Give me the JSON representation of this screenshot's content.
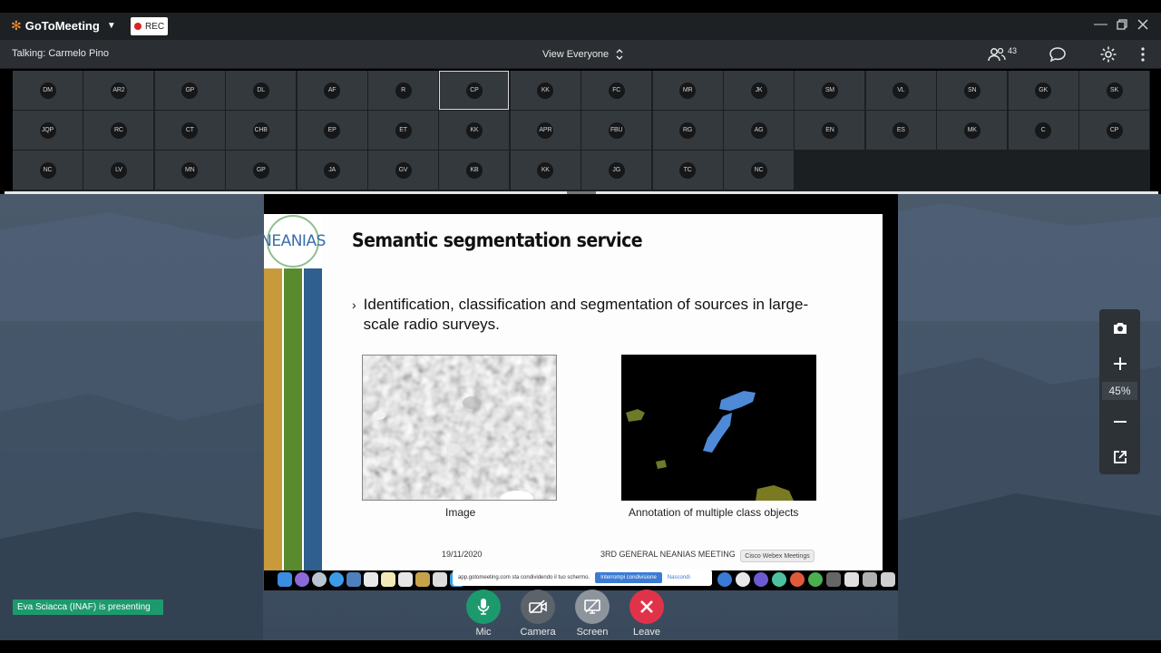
{
  "app": {
    "name": "GoToMeeting",
    "rec_label": "REC"
  },
  "topbar": {
    "talking": "Talking: Carmelo Pino",
    "view_label": "View Everyone",
    "participant_count": "43"
  },
  "participants": [
    "DM",
    "AR2",
    "GP",
    "DL",
    "AF",
    "R",
    "CP",
    "KK",
    "FC",
    "MR",
    "JK",
    "SM",
    "VL",
    "SN",
    "GK",
    "SK",
    "JQP",
    "RC",
    "CT",
    "CHB",
    "EP",
    "ET",
    "KK",
    "APR",
    "FBU",
    "RG",
    "AG",
    "EN",
    "ES",
    "MK",
    "C",
    "CP",
    "NC",
    "LV",
    "MN",
    "GP",
    "JA",
    "GV",
    "KB",
    "KK",
    "JG",
    "TC",
    "NC"
  ],
  "active_participant_index": 6,
  "slide": {
    "logo_text": "NEANIAS",
    "title": "Semantic segmentation service",
    "bullet_marker": "›",
    "bullet": "Identification, classification and segmentation of sources in large-scale radio surveys.",
    "caption_left": "Image",
    "caption_right": "Annotation of multiple class objects",
    "date": "19/11/2020",
    "footer": "3RD GENERAL NEANIAS MEETING",
    "webex_label": "Cisco Webex Meetings",
    "share_notice": "app.gotomeeting.com sta condividendo il tuo schermo.",
    "share_stop": "Interrompi condivisione",
    "share_hide": "Nascondi"
  },
  "zoom": {
    "level": "45%"
  },
  "presenter_banner": "Eva Sciacca (INAF) is presenting",
  "controls": {
    "mic": "Mic",
    "camera": "Camera",
    "screen": "Screen",
    "leave": "Leave"
  },
  "colors": {
    "accent_green": "#1c9a6e",
    "leave_red": "#e0334a",
    "brand_orange": "#f68d2e"
  }
}
